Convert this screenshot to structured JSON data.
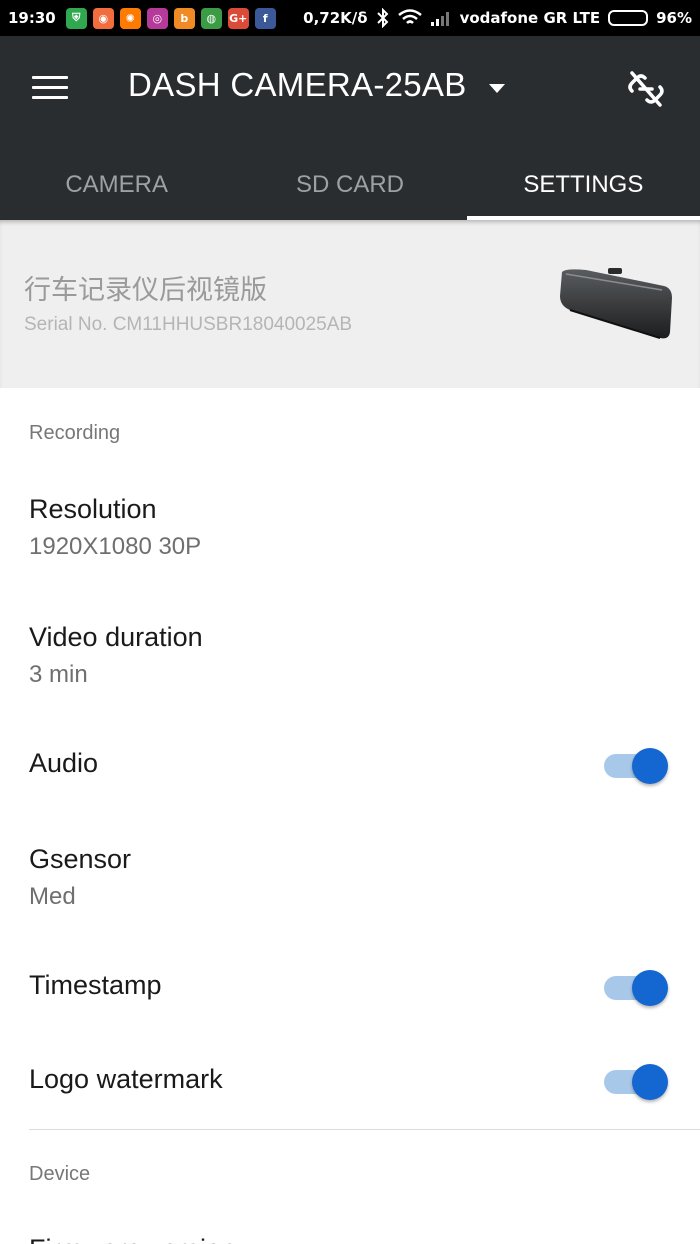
{
  "status_bar": {
    "time": "19:30",
    "speed": "0,72K/δ",
    "carrier": "vodafone GR LTE",
    "battery": "96%",
    "battery_level": 0.96,
    "notification_icons": [
      {
        "name": "shield-app-icon",
        "color": "#2fa84f",
        "glyph": "⛨"
      },
      {
        "name": "orange-app-icon",
        "color": "#f26d3d",
        "glyph": "◉"
      },
      {
        "name": "soundcloud-icon",
        "color": "#ff7a00",
        "glyph": "✺"
      },
      {
        "name": "instagram-icon",
        "color": "#b53a9a",
        "glyph": "◎"
      },
      {
        "name": "blogger-icon",
        "color": "#f08a24",
        "glyph": "b"
      },
      {
        "name": "chrome-icon",
        "color": "#3c9b45",
        "glyph": "◍"
      },
      {
        "name": "google-plus-icon",
        "color": "#dc4a38",
        "glyph": "G+"
      },
      {
        "name": "facebook-icon",
        "color": "#3b5998",
        "glyph": "f"
      }
    ]
  },
  "app_bar": {
    "title": "DASH CAMERA-25AB",
    "tabs": [
      {
        "label": "CAMERA",
        "active": false
      },
      {
        "label": "SD CARD",
        "active": false
      },
      {
        "label": "SETTINGS",
        "active": true
      }
    ]
  },
  "device": {
    "name": "行车记录仪后视镜版",
    "serial": "Serial No. CM11HHUSBR18040025AB"
  },
  "settings": {
    "recording_header": "Recording",
    "resolution": {
      "title": "Resolution",
      "value": "1920X1080 30P"
    },
    "video_duration": {
      "title": "Video duration",
      "value": "3 min"
    },
    "audio": {
      "title": "Audio",
      "enabled": true
    },
    "gsensor": {
      "title": "Gsensor",
      "value": "Med"
    },
    "timestamp": {
      "title": "Timestamp",
      "enabled": true
    },
    "logo_watermark": {
      "title": "Logo watermark",
      "enabled": true
    },
    "device_header": "Device",
    "next_item_title": "Firmware version"
  },
  "colors": {
    "app_bar": "#2a2d30",
    "accent": "#1467d1",
    "toggle_track": "#a8c8ea"
  }
}
